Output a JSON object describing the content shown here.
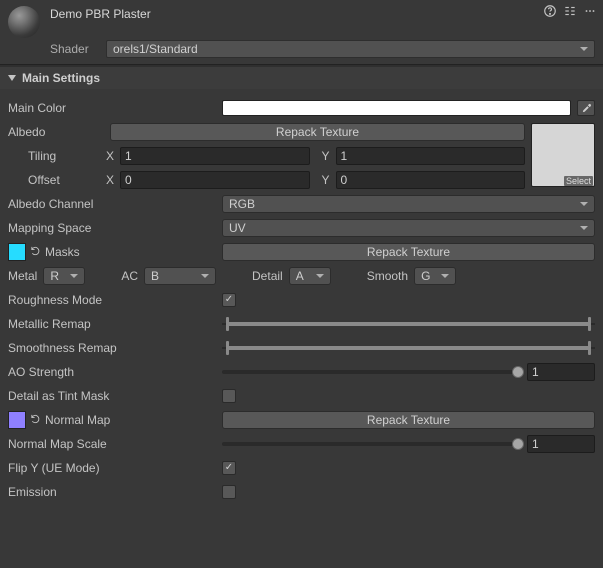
{
  "header": {
    "title": "Demo PBR Plaster",
    "shaderLabel": "Shader",
    "shaderValue": "orels1/Standard",
    "helpIcon": "help-icon",
    "presetIcon": "preset-icon",
    "menuIcon": "menu-icon"
  },
  "section": {
    "title": "Main Settings"
  },
  "labels": {
    "mainColor": "Main Color",
    "albedo": "Albedo",
    "repackTexture": "Repack Texture",
    "tiling": "Tiling",
    "offset": "Offset",
    "x": "X",
    "y": "Y",
    "select": "Select",
    "albedoChannel": "Albedo Channel",
    "mappingSpace": "Mapping Space",
    "masks": "Masks",
    "metal": "Metal",
    "ac": "AC",
    "detail": "Detail",
    "smooth": "Smooth",
    "roughnessMode": "Roughness Mode",
    "metallicRemap": "Metallic Remap",
    "smoothnessRemap": "Smoothness Remap",
    "aoStrength": "AO Strength",
    "detailTint": "Detail as Tint Mask",
    "normalMap": "Normal Map",
    "normalScale": "Normal Map Scale",
    "flipY": "Flip Y (UE Mode)",
    "emission": "Emission"
  },
  "values": {
    "tilingX": "1",
    "tilingY": "1",
    "offsetX": "0",
    "offsetY": "0",
    "albedoChannel": "RGB",
    "mappingSpace": "UV",
    "metal": "R",
    "ac": "B",
    "detail": "A",
    "smooth": "G",
    "roughnessMode": true,
    "metallicRemap": {
      "min": 0.01,
      "max": 0.99
    },
    "smoothnessRemap": {
      "min": 0.01,
      "max": 0.99
    },
    "aoStrength": "1",
    "aoSlider": 1.0,
    "detailTint": false,
    "normalScale": "1",
    "normalSlider": 1.0,
    "flipY": true,
    "emission": false
  },
  "colors": {
    "masksSwatch": "#26dcff",
    "normalSwatch": "#8f80ff",
    "mainColor": "#ffffff"
  }
}
